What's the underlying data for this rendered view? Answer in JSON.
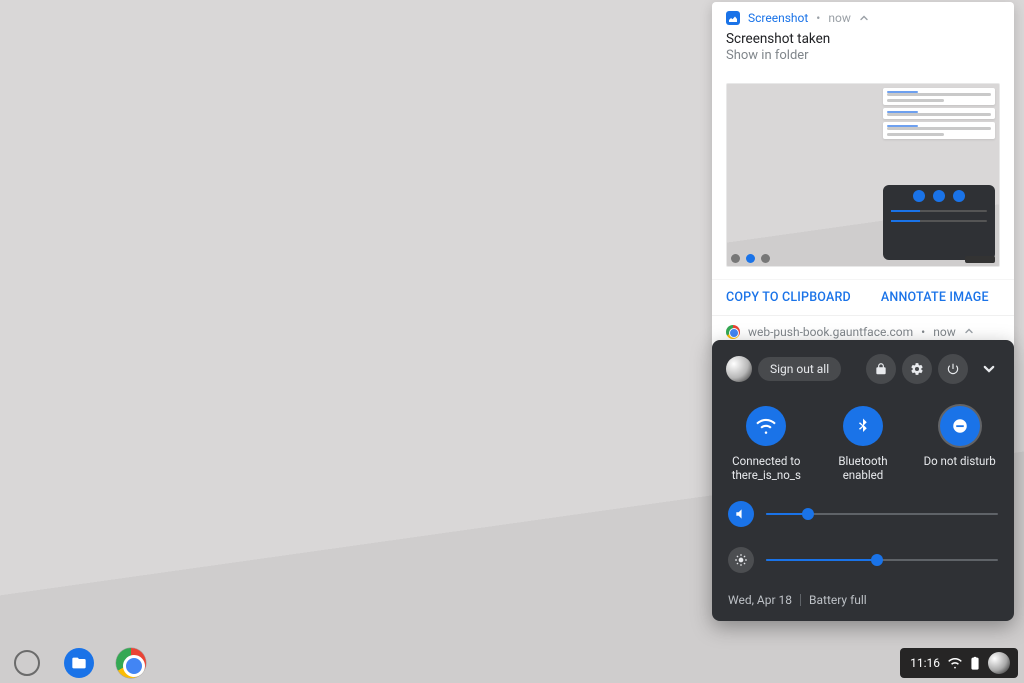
{
  "notification": {
    "app_name": "Screenshot",
    "timestamp": "now",
    "title": "Screenshot taken",
    "subtitle": "Show in folder",
    "actions": {
      "copy": "COPY TO CLIPBOARD",
      "annotate": "ANNOTATE IMAGE"
    }
  },
  "notification2": {
    "source": "web-push-book.gauntface.com",
    "timestamp": "now"
  },
  "quick_settings": {
    "sign_out_label": "Sign out all",
    "tiles": {
      "wifi": {
        "title": "Connected to",
        "subtitle": "there_is_no_s"
      },
      "bluetooth": {
        "title": "Bluetooth",
        "subtitle": "enabled"
      },
      "dnd": {
        "title": "Do not disturb",
        "subtitle": ""
      }
    },
    "volume_percent": 18,
    "brightness_percent": 48,
    "date": "Wed, Apr 18",
    "battery_status": "Battery full"
  },
  "tray": {
    "clock": "11:16"
  },
  "colors": {
    "accent": "#1a73e8",
    "panel_bg": "#2f3135"
  }
}
